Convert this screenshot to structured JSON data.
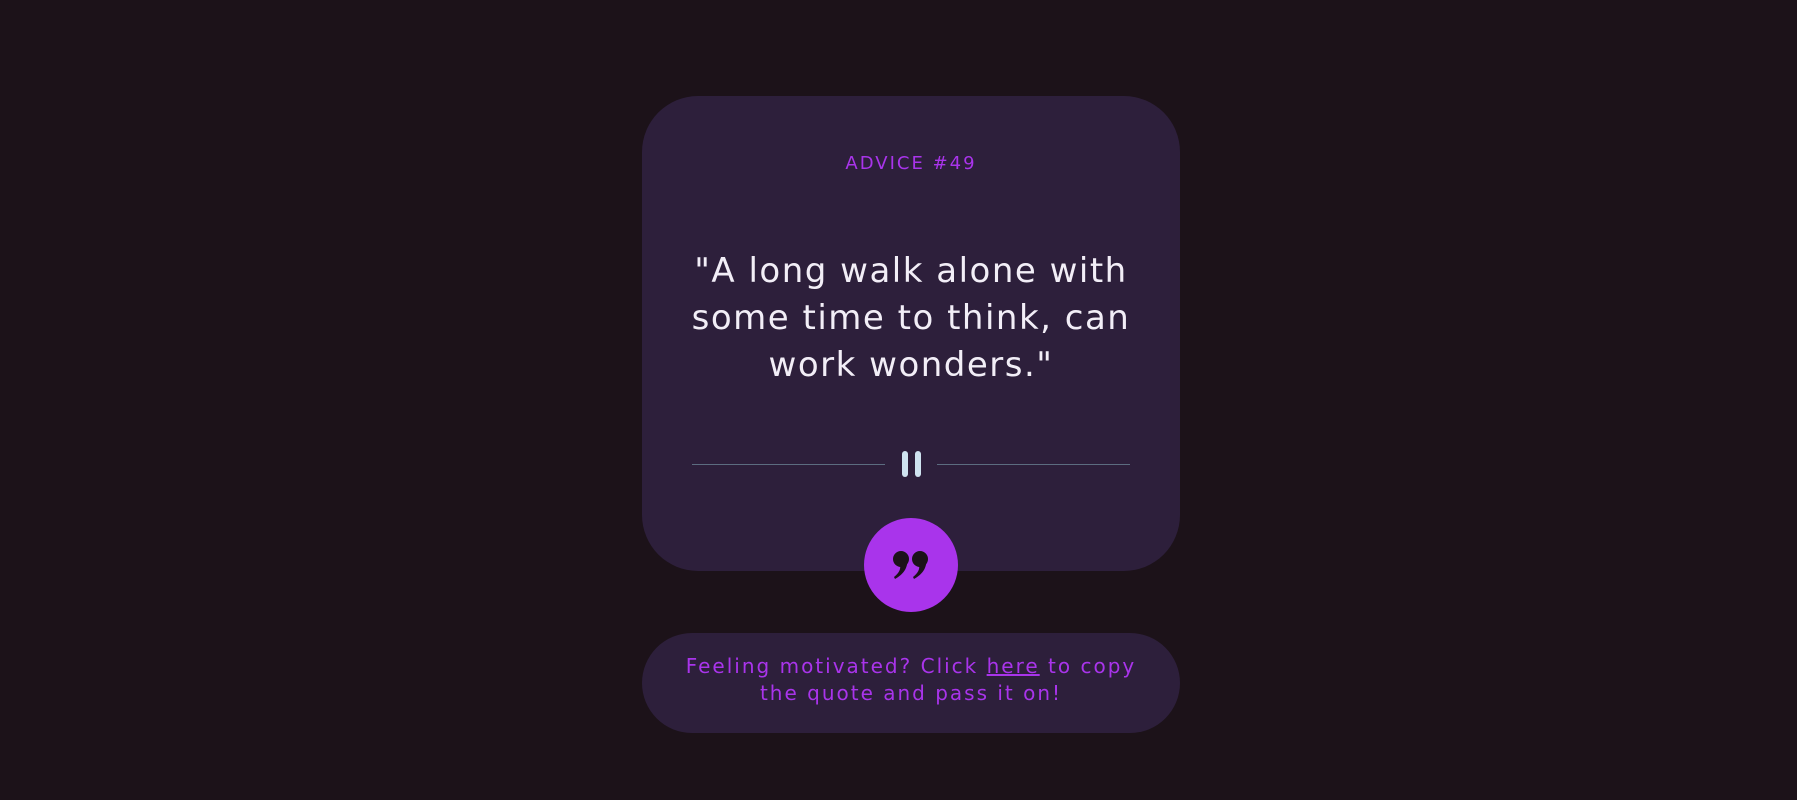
{
  "card": {
    "advice_label": "ADVICE #49",
    "quote": "\"A long walk alone with some time to think, can work wonders.\"",
    "divider_icon": "pause-icon"
  },
  "quote_button": {
    "icon": "quote-icon"
  },
  "share": {
    "text_before": "Feeling motivated? Click ",
    "link_label": "here",
    "text_after": " to copy the quote and pass it on!"
  },
  "colors": {
    "background": "#1c1219",
    "card": "#2d1f3b",
    "accent": "#a934eb",
    "quote_text": "#f2eef7",
    "divider_line": "#5c6c80",
    "pause_bars": "#cfe3f0"
  }
}
